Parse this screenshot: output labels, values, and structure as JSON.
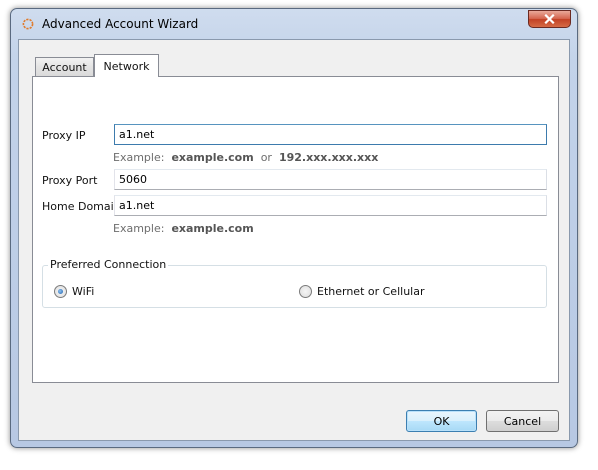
{
  "window": {
    "title": "Advanced Account Wizard"
  },
  "tabs": [
    {
      "label": "Account",
      "selected": false
    },
    {
      "label": "Network",
      "selected": true
    }
  ],
  "form": {
    "proxy_ip": {
      "label": "Proxy IP",
      "value": "a1.net"
    },
    "proxy_ip_hint": {
      "prefix": "Example:",
      "example1": "example.com",
      "joiner": "or",
      "example2": "192.xxx.xxx.xxx"
    },
    "proxy_port": {
      "label": "Proxy Port",
      "value": "5060"
    },
    "home_domain": {
      "label": "Home Domain",
      "value": "a1.net"
    },
    "home_domain_hint": {
      "prefix": "Example:",
      "example": "example.com"
    }
  },
  "preferred_connection": {
    "legend": "Preferred Connection",
    "options": [
      {
        "label": "WiFi",
        "selected": true
      },
      {
        "label": "Ethernet or Cellular",
        "selected": false
      }
    ]
  },
  "buttons": {
    "ok": "OK",
    "cancel": "Cancel"
  },
  "colors": {
    "accent": "#3c7fb1",
    "close_button": "#c24125",
    "hint_text": "#6d6d6d"
  }
}
